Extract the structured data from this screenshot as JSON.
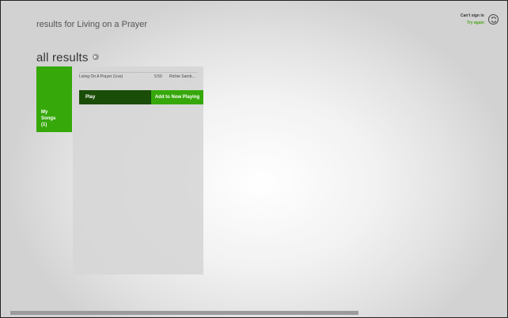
{
  "header": {
    "search_title": "results for Living on a Prayer",
    "sign_in_status": "Can't sign in",
    "retry_label": "Try again",
    "sync_icon": "sync-icon"
  },
  "section": {
    "heading": "all results"
  },
  "tile": {
    "label": "My\nSongs\n(1)",
    "color": "#36a80a"
  },
  "results": {
    "rows": [
      {
        "title": "Living On A Prayer (Live)",
        "duration": "5:50",
        "artist": "Richie Samb..."
      }
    ]
  },
  "actions": {
    "play_label": "Play",
    "add_label": "Add to Now Playing"
  },
  "colors": {
    "accent": "#36a80a",
    "accent_dark": "#1a4d08",
    "link": "#4aa81a"
  }
}
